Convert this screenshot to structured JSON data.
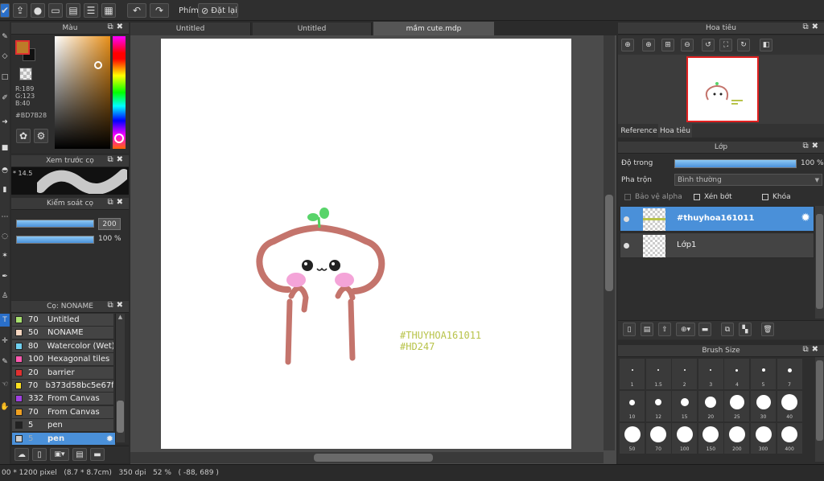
{
  "toolbar": {
    "shortcut_label": "Phím",
    "reset_label": "Đặt lại"
  },
  "tabs": [
    {
      "label": "Untitled"
    },
    {
      "label": "Untitled"
    },
    {
      "label": "mầm cute.mdp"
    }
  ],
  "color_panel": {
    "title": "Màu",
    "r": "R:189",
    "g": "G:123",
    "b": "B:40",
    "hex": "#BD7B28",
    "current_color": "#BD7B28"
  },
  "brush_preview": {
    "title": "Xem trước cọ",
    "size_text": "* 14.5"
  },
  "brush_control": {
    "title": "Kiểm soát cọ",
    "size_value": "200",
    "opacity_value": "100 %",
    "opacity_fraction": 1.0
  },
  "brush_list": {
    "title": "Cọ: NONAME",
    "items": [
      {
        "color": "#a8e06e",
        "size": "70",
        "name": "Untitled"
      },
      {
        "color": "#f6d6c0",
        "size": "50",
        "name": "NONAME"
      },
      {
        "color": "#6fd0f0",
        "size": "80",
        "name": "Watercolor (Wet)"
      },
      {
        "color": "#ff5ab0",
        "size": "100",
        "name": "Hexagonal tiles"
      },
      {
        "color": "#e03030",
        "size": "20",
        "name": "barrier"
      },
      {
        "color": "#ffe020",
        "size": "70",
        "name": "b373d58bc5e67f3"
      },
      {
        "color": "#a040e0",
        "size": "332",
        "name": "From Canvas"
      },
      {
        "color": "#f0a020",
        "size": "70",
        "name": "From Canvas"
      },
      {
        "color": "#222222",
        "size": "5",
        "name": "pen"
      },
      {
        "color": "#cccccc",
        "size": "5",
        "name": "pen",
        "selected": true
      }
    ]
  },
  "canvas": {
    "caption_line1": "#THUYHOA161011",
    "caption_line2": "#HD247"
  },
  "navigator": {
    "title": "Hoa tiêu",
    "tab_reference": "Reference",
    "tab_navigator": "Hoa tiêu"
  },
  "layer_panel": {
    "title": "Lớp",
    "opacity_label": "Độ trong",
    "opacity_value": "100 %",
    "opacity_fraction": 1.0,
    "blend_label": "Pha trộn",
    "blend_value": "Bình thường",
    "protect_alpha": "Bảo vệ alpha",
    "clipping": "Xén bớt",
    "lock": "Khóa",
    "layers": [
      {
        "name": "#thuyhoa161011",
        "selected": true
      },
      {
        "name": "Lớp1",
        "selected": false
      }
    ]
  },
  "brush_size": {
    "title": "Brush Size",
    "row1": [
      "1",
      "1.5",
      "2",
      "3",
      "4",
      "5",
      "7"
    ],
    "row2": [
      "10",
      "12",
      "15",
      "20",
      "25",
      "30",
      "40"
    ],
    "row3": [
      "50",
      "70",
      "100",
      "150",
      "200",
      "300",
      "400"
    ]
  },
  "status": {
    "text": "00 * 1200 pixel   (8.7 * 8.7cm)   350 dpi   52 %   ( -88, 689 )"
  },
  "colors": {
    "accent": "#4a90d9",
    "bg": "#2b2b2b",
    "panel": "#3a3a3a"
  }
}
